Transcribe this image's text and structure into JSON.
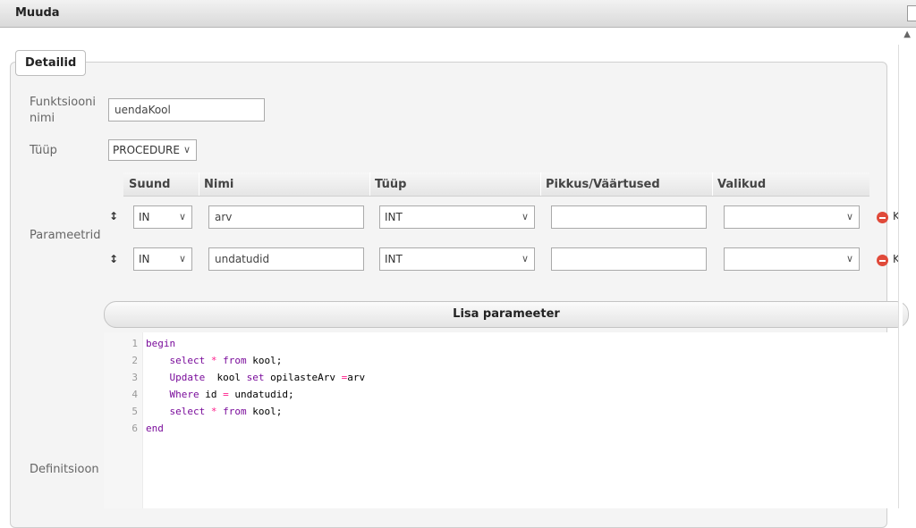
{
  "window": {
    "title": "Muuda"
  },
  "tab": {
    "label": "Detailid"
  },
  "form": {
    "function_name_label": "Funktsiooni nimi",
    "function_name_line1": "Funktsiooni",
    "function_name_line2": "nimi",
    "function_name_value": "uendaKool",
    "type_label": "Tüüp",
    "type_value": "PROCEDURE",
    "parameters_label": "Parameetrid",
    "definition_label": "Definitsioon"
  },
  "params_table": {
    "headers": [
      "Suund",
      "Nimi",
      "Tüüp",
      "Pikkus/Väärtused",
      "Valikud"
    ],
    "rows": [
      {
        "direction": "IN",
        "name": "arv",
        "type": "INT",
        "length": "",
        "options": ""
      },
      {
        "direction": "IN",
        "name": "undatudid",
        "type": "INT",
        "length": "",
        "options": ""
      }
    ],
    "remove_label": "K"
  },
  "add_param_button": "Lisa parameeter",
  "editor": {
    "line_numbers": [
      "1",
      "2",
      "3",
      "4",
      "5",
      "6"
    ],
    "lines": [
      [
        {
          "t": "begin",
          "c": "kw"
        }
      ],
      [
        {
          "t": "    "
        },
        {
          "t": "select",
          "c": "kw"
        },
        {
          "t": " "
        },
        {
          "t": "*",
          "c": "op"
        },
        {
          "t": " "
        },
        {
          "t": "from",
          "c": "kw"
        },
        {
          "t": " kool;"
        }
      ],
      [
        {
          "t": "    "
        },
        {
          "t": "Update",
          "c": "kw"
        },
        {
          "t": "  kool "
        },
        {
          "t": "set",
          "c": "kw"
        },
        {
          "t": " opilasteArv "
        },
        {
          "t": "=",
          "c": "op"
        },
        {
          "t": "arv"
        }
      ],
      [
        {
          "t": "    "
        },
        {
          "t": "Where",
          "c": "kw"
        },
        {
          "t": " id "
        },
        {
          "t": "=",
          "c": "op"
        },
        {
          "t": " undatudid;"
        }
      ],
      [
        {
          "t": "    "
        },
        {
          "t": "select",
          "c": "kw"
        },
        {
          "t": " "
        },
        {
          "t": "*",
          "c": "op"
        },
        {
          "t": " "
        },
        {
          "t": "from",
          "c": "kw"
        },
        {
          "t": " kool;"
        }
      ],
      [
        {
          "t": "end",
          "c": "kw"
        }
      ]
    ]
  }
}
